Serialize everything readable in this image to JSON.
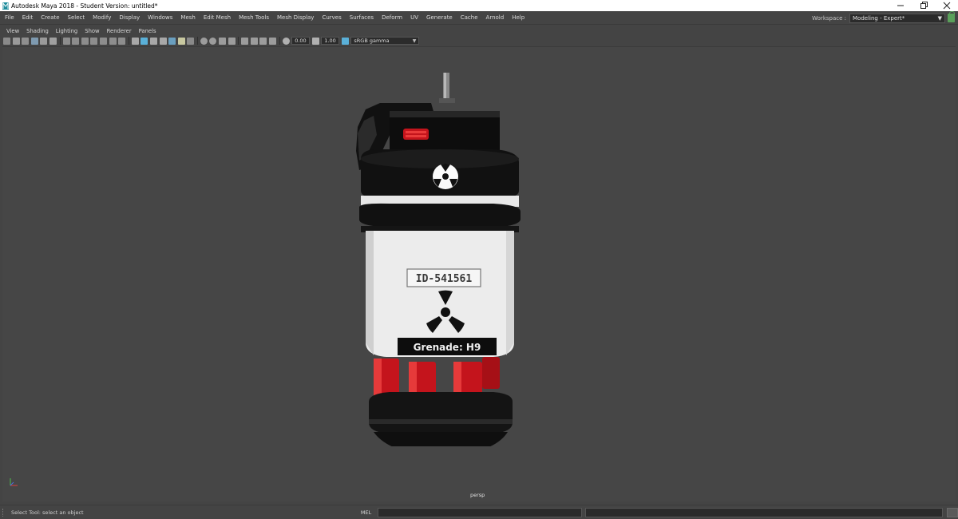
{
  "window": {
    "title": "Autodesk Maya 2018 - Student Version: untitled*",
    "controls": [
      "minimize",
      "maximize",
      "close"
    ]
  },
  "menubar": {
    "items": [
      "File",
      "Edit",
      "Create",
      "Select",
      "Modify",
      "Display",
      "Windows",
      "Mesh",
      "Edit Mesh",
      "Mesh Tools",
      "Mesh Display",
      "Curves",
      "Surfaces",
      "Deform",
      "UV",
      "Generate",
      "Cache",
      "Arnold",
      "Help"
    ],
    "workspace_label": "Workspace :",
    "workspace_value": "Modeling - Expert*"
  },
  "panel_menu": {
    "items": [
      "View",
      "Shading",
      "Lighting",
      "Show",
      "Renderer",
      "Panels"
    ]
  },
  "toolbar": {
    "exposure_value": "0.00",
    "gamma_value": "1.00",
    "colorspace_value": "sRGB gamma"
  },
  "viewport": {
    "camera_label": "persp",
    "model": {
      "id_label": "ID-541561",
      "name_label": "Grenade: H9"
    }
  },
  "statusbar": {
    "help_text": "Select Tool: select an object",
    "mel_label": "MEL"
  },
  "colors": {
    "ui_background": "#444444",
    "viewport_background": "#464646",
    "field_background": "#2b2b2b",
    "accent_red": "#c4141c"
  }
}
